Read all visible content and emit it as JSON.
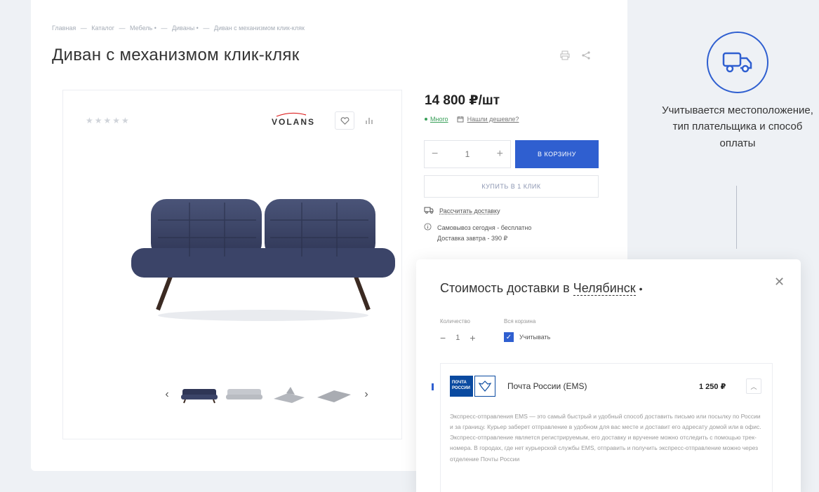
{
  "breadcrumb": [
    "Главная",
    "—",
    "Каталог",
    "—",
    "Мебель •",
    "—",
    "Диваны •",
    "—",
    "Диван с механизмом клик-кляк"
  ],
  "product": {
    "title": "Диван с механизмом клик-кляк",
    "brand": "VOLANS",
    "rating_stars": "★★★★★",
    "price": "14 800 ₽/шт",
    "stock": "Много",
    "cheaper_link": "Нашли дешевле?",
    "quantity": "1",
    "minus": "−",
    "plus": "+",
    "cart_button": "В КОРЗИНУ",
    "oneclick_button": "КУПИТЬ В 1 КЛИК",
    "calc_delivery": "Рассчитать доставку",
    "pickup_line1": "Самовывоз сегодня - бесплатно",
    "pickup_line2": "Доставка завтра - 390 ₽",
    "prev_arrow": "‹",
    "next_arrow": "›"
  },
  "side_panel": {
    "text": "Учитывается местоположение, тип плательщика и способ оплаты"
  },
  "popup": {
    "title_prefix": "Стоимость доставки в",
    "city": "Челябинск",
    "city_dot": "•",
    "close": "✕",
    "qty_label": "Количество",
    "cart_label": "Вся корзина",
    "qty_value": "1",
    "minus": "−",
    "plus": "+",
    "consider_label": "Учитывать",
    "checkmark": "✓",
    "shipping": {
      "logo_line1": "ПОЧТА",
      "logo_line2": "РОССИИ",
      "name": "Почта России (EMS)",
      "price": "1 250 ₽",
      "toggle": "︿",
      "description": "Экспресс-отправления EMS — это самый быстрый и удобный способ доставить письмо или посылку по России и за границу. Курьер заберет отправление в удобном для вас месте и доставит его адресату домой или в офис. Экспресс-отправление является регистрируемым, его доставку и вручение можно отследить с помощью трек-номера. В городах, где нет курьерской службы EMS, отправить и получить экспресс-отправление можно через отделение Почты России"
    }
  },
  "colors": {
    "accent": "#2f5fd0",
    "stock_green": "#3aa05a",
    "sofa": "#3b4468",
    "background": "#eef1f5"
  }
}
